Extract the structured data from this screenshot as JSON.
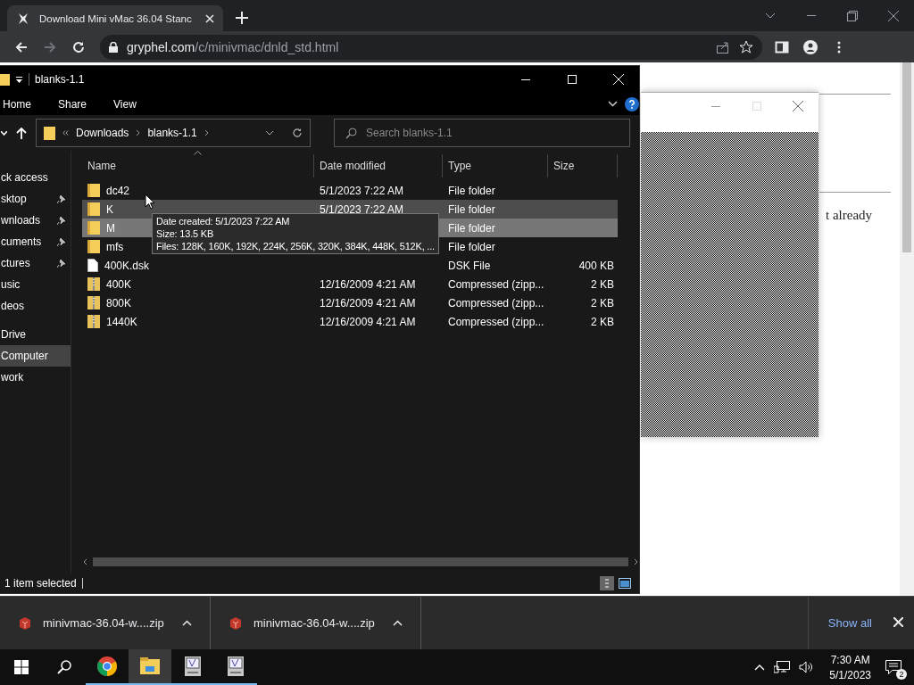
{
  "browser": {
    "tab": {
      "title": "Download Mini vMac 36.04 Stanc",
      "selected": true
    },
    "url_domain": "gryphel.com",
    "url_path": "/c/minivmac/dnld_std.html",
    "page_text": "t already"
  },
  "explorer": {
    "title": "blanks-1.1",
    "ribbon_tabs": [
      "Home",
      "Share",
      "View"
    ],
    "breadcrumb": [
      "Downloads",
      "blanks-1.1"
    ],
    "search": {
      "placeholder": "Search blanks-1.1"
    },
    "sidebar": [
      {
        "kind": "header",
        "label": "ck access",
        "selected": false
      },
      {
        "kind": "pinned",
        "label": "sktop",
        "selected": false
      },
      {
        "kind": "pinned",
        "label": "wnloads",
        "selected": false
      },
      {
        "kind": "pinned",
        "label": "cuments",
        "selected": false
      },
      {
        "kind": "pinned",
        "label": "ctures",
        "selected": false
      },
      {
        "kind": "item",
        "label": "usic",
        "selected": false
      },
      {
        "kind": "item",
        "label": "deos",
        "selected": false
      },
      {
        "kind": "root",
        "label": "Drive",
        "selected": false
      },
      {
        "kind": "root",
        "label": "Computer",
        "selected": true
      },
      {
        "kind": "root",
        "label": "work",
        "selected": false
      }
    ],
    "columns": [
      "Name",
      "Date modified",
      "Type",
      "Size"
    ],
    "rows": [
      {
        "kind": "folder",
        "name": "dc42",
        "date": "5/1/2023 7:22 AM",
        "type": "File folder",
        "selected": false,
        "hovered": false
      },
      {
        "kind": "folder",
        "name": "K",
        "date": "5/1/2023 7:22 AM",
        "type": "File folder",
        "selected": false,
        "hovered": true
      },
      {
        "kind": "folder",
        "name": "M",
        "type": "File folder",
        "selected": true,
        "hovered": false
      },
      {
        "kind": "folder",
        "name": "mfs",
        "type": "File folder",
        "selected": false,
        "hovered": false
      },
      {
        "kind": "file",
        "name": "400K.dsk",
        "type": "DSK File",
        "size": "400 KB",
        "selected": false,
        "hovered": false
      },
      {
        "kind": "zip",
        "name": "400K",
        "date": "12/16/2009 4:21 AM",
        "type": "Compressed (zipp...",
        "size": "2 KB",
        "selected": false,
        "hovered": false
      },
      {
        "kind": "zip",
        "name": "800K",
        "date": "12/16/2009 4:21 AM",
        "type": "Compressed (zipp...",
        "size": "2 KB",
        "selected": false,
        "hovered": false
      },
      {
        "kind": "zip",
        "name": "1440K",
        "date": "12/16/2009 4:21 AM",
        "type": "Compressed (zipp...",
        "size": "2 KB",
        "selected": false,
        "hovered": false
      }
    ],
    "tooltip": [
      "Date created: 5/1/2023 7:22 AM",
      "Size: 13.5 KB",
      "Files: 128K, 160K, 192K, 224K, 256K, 320K, 384K, 448K, 512K, ..."
    ],
    "status": "1 item selected"
  },
  "downloads": {
    "items": [
      "minivmac-36.04-w....zip",
      "minivmac-36.04-w....zip"
    ],
    "show_all": "Show all"
  },
  "taskbar": {
    "apps": [
      {
        "kind": "chrome",
        "active": false
      },
      {
        "kind": "explorer",
        "active": true
      },
      {
        "kind": "emulator",
        "active": false
      },
      {
        "kind": "emulator",
        "active": false
      }
    ],
    "time": "7:30 AM",
    "date": "5/1/2023",
    "notifications": "2"
  }
}
